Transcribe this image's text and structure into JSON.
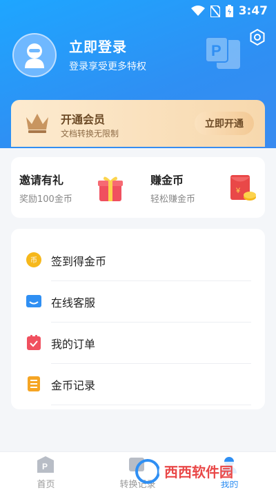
{
  "status_bar": {
    "time": "3:47",
    "icons": [
      "wifi-icon",
      "no-sim-icon",
      "battery-icon"
    ]
  },
  "header": {
    "title": "立即登录",
    "subtitle": "登录享受更多特权",
    "settings_icon": "gear-icon"
  },
  "vip": {
    "title": "开通会员",
    "subtitle": "文档转换无限制",
    "button": "立即开通"
  },
  "promo": [
    {
      "title": "邀请有礼",
      "subtitle": "奖励100金币",
      "icon": "gift-icon"
    },
    {
      "title": "赚金币",
      "subtitle": "轻松赚金币",
      "icon": "red-envelope-icon"
    }
  ],
  "menu": [
    {
      "label": "签到得金币",
      "icon": "coin-icon",
      "color": "#f6b81b"
    },
    {
      "label": "在线客服",
      "icon": "customer-service-icon",
      "color": "#2f8ff3"
    },
    {
      "label": "我的订单",
      "icon": "order-icon",
      "color": "#f0505f"
    },
    {
      "label": "金币记录",
      "icon": "record-icon",
      "color": "#f5a524"
    }
  ],
  "nav": [
    {
      "label": "首页",
      "icon": "home-icon"
    },
    {
      "label": "转换记录",
      "icon": "history-icon"
    },
    {
      "label": "我的",
      "icon": "profile-icon"
    }
  ],
  "watermark": "西西软件园",
  "colors": {
    "accent": "#2f8ff3",
    "header": "#1ea6ff",
    "vip_text": "#6c4a26"
  }
}
